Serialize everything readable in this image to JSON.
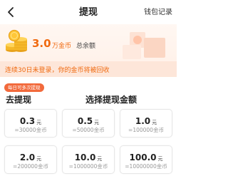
{
  "header": {
    "title": "提现",
    "wallet_link": "钱包记录"
  },
  "balance": {
    "amount": "3.0",
    "unit": "万金币",
    "label": "总余额"
  },
  "notice": "连续30日未登录，你的金币将被回收",
  "badge": "每日可多次提现",
  "left_heading": "去提现",
  "right_heading": "选择提现金额",
  "options": [
    {
      "amount": "0.3",
      "unit": "元",
      "coins": "=30000金币"
    },
    {
      "amount": "0.5",
      "unit": "元",
      "coins": "=50000金币"
    },
    {
      "amount": "1.0",
      "unit": "元",
      "coins": "=100000金币"
    },
    {
      "amount": "2.0",
      "unit": "元",
      "coins": "=200000金币"
    },
    {
      "amount": "10.0",
      "unit": "元",
      "coins": "=1000000金币"
    },
    {
      "amount": "100.0",
      "unit": "元",
      "coins": "=10000000金币"
    }
  ],
  "colors": {
    "accent": "#f06a10",
    "notice_bg": "#fde6d9",
    "badge_bg": "#f26a3c",
    "balance_bg": "#fff4ec"
  },
  "icons": {
    "back": "chevron-left-icon",
    "coins": "coin-stack-icon",
    "deco": "decorative-boxes-icon"
  }
}
